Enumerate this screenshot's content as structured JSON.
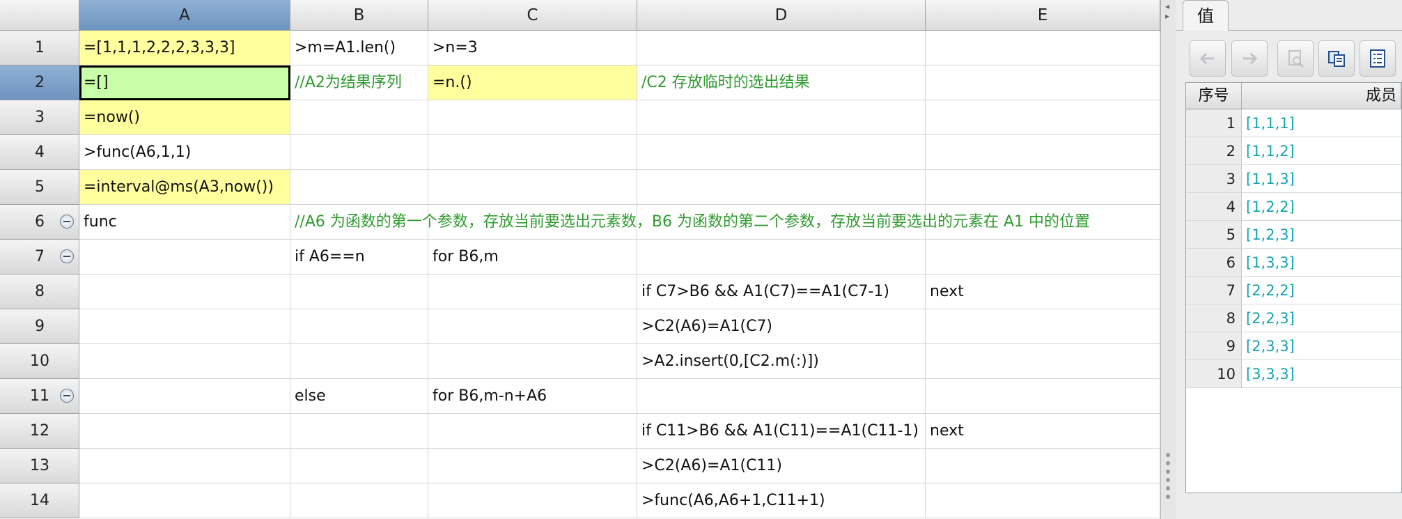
{
  "columns": [
    "A",
    "B",
    "C",
    "D",
    "E"
  ],
  "selected_column": "A",
  "selected_row": 2,
  "rows": [
    {
      "num": "1",
      "collapse": false,
      "cells": {
        "A": "=[1,1,1,2,2,2,3,3,3]",
        "B": ">m=A1.len()",
        "C": ">n=3",
        "D": "",
        "E": ""
      }
    },
    {
      "num": "2",
      "collapse": false,
      "cells": {
        "A": "=[]",
        "B": "//A2为结果序列",
        "C": "=n.()",
        "D": "/C2 存放临时的选出结果",
        "E": ""
      }
    },
    {
      "num": "3",
      "collapse": false,
      "cells": {
        "A": "=now()",
        "B": "",
        "C": "",
        "D": "",
        "E": ""
      }
    },
    {
      "num": "4",
      "collapse": false,
      "cells": {
        "A": ">func(A6,1,1)",
        "B": "",
        "C": "",
        "D": "",
        "E": ""
      }
    },
    {
      "num": "5",
      "collapse": false,
      "cells": {
        "A": "=interval@ms(A3,now())",
        "B": "",
        "C": "",
        "D": "",
        "E": ""
      }
    },
    {
      "num": "6",
      "collapse": true,
      "cells": {
        "A": "func",
        "B": "//A6 为函数的第一个参数，存放当前要选出元素数，B6 为函数的第二个参数，存放当前要选出的元素在 A1 中的位置",
        "C": "",
        "D": "",
        "E": ""
      }
    },
    {
      "num": "7",
      "collapse": true,
      "cells": {
        "A": "",
        "B": "if A6==n",
        "C": "for B6,m",
        "D": "",
        "E": ""
      }
    },
    {
      "num": "8",
      "collapse": false,
      "cells": {
        "A": "",
        "B": "",
        "C": "",
        "D": "if C7>B6 && A1(C7)==A1(C7-1)",
        "E": "next"
      }
    },
    {
      "num": "9",
      "collapse": false,
      "cells": {
        "A": "",
        "B": "",
        "C": "",
        "D": ">C2(A6)=A1(C7)",
        "E": ""
      }
    },
    {
      "num": "10",
      "collapse": false,
      "cells": {
        "A": "",
        "B": "",
        "C": "",
        "D": ">A2.insert(0,[C2.m(:)])",
        "E": ""
      }
    },
    {
      "num": "11",
      "collapse": true,
      "cells": {
        "A": "",
        "B": "else",
        "C": "for B6,m-n+A6",
        "D": "",
        "E": ""
      }
    },
    {
      "num": "12",
      "collapse": false,
      "cells": {
        "A": "",
        "B": "",
        "C": "",
        "D": "if C11>B6 && A1(C11)==A1(C11-1)",
        "E": "next"
      }
    },
    {
      "num": "13",
      "collapse": false,
      "cells": {
        "A": "",
        "B": "",
        "C": "",
        "D": ">C2(A6)=A1(C11)",
        "E": ""
      }
    },
    {
      "num": "14",
      "collapse": false,
      "cells": {
        "A": "",
        "B": "",
        "C": "",
        "D": ">func(A6,A6+1,C11+1)",
        "E": ""
      }
    }
  ],
  "panel": {
    "tab_label": "值",
    "toolbar": {
      "back_icon": "arrow-left-icon",
      "forward_icon": "arrow-right-icon",
      "zoom_icon": "zoom-icon",
      "copy_icon": "copy-icon",
      "list_icon": "list-icon"
    },
    "table": {
      "header_index": "序号",
      "header_member": "成员",
      "rows": [
        {
          "index": "1",
          "value": "[1,1,1]"
        },
        {
          "index": "2",
          "value": "[1,1,2]"
        },
        {
          "index": "3",
          "value": "[1,1,3]"
        },
        {
          "index": "4",
          "value": "[1,2,2]"
        },
        {
          "index": "5",
          "value": "[1,2,3]"
        },
        {
          "index": "6",
          "value": "[1,3,3]"
        },
        {
          "index": "7",
          "value": "[2,2,2]"
        },
        {
          "index": "8",
          "value": "[2,2,3]"
        },
        {
          "index": "9",
          "value": "[2,3,3]"
        },
        {
          "index": "10",
          "value": "[3,3,3]"
        }
      ]
    }
  },
  "colors": {
    "yellow_cell": "#ffff9e",
    "green_cell": "#c8ffa8",
    "comment_text": "#2f9a2f",
    "value_text": "#13a4b4",
    "selected_header": "#7a9ec8"
  }
}
